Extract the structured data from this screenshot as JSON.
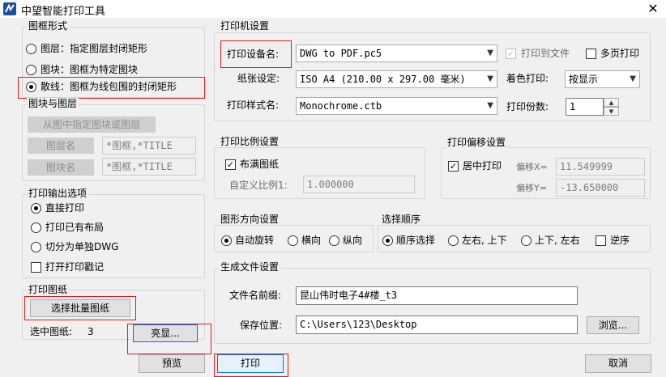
{
  "window": {
    "title": "中望智能打印工具",
    "close": "✕"
  },
  "frame": {
    "title": "图框形式",
    "options": [
      "图层：指定图层封闭矩形",
      "图块：图框为特定图块",
      "散线：图框为线包围的封闭矩形"
    ],
    "selected": 2
  },
  "block_layer": {
    "title": "图块与图层",
    "pick_button": "从图中指定图块或图层",
    "layer_button": "图层名",
    "layer_value": "*图框,*TITLE",
    "block_button": "图块名",
    "block_value": "*图框,*TITLE"
  },
  "output": {
    "title": "打印输出选项",
    "options": [
      "直接打印",
      "打印已有布局",
      "切分为单独DWG"
    ],
    "selected": 0,
    "stamp_label": "打开打印戳记"
  },
  "drawings": {
    "title": "打印图纸",
    "select_button": "选择批量图纸",
    "selected_label": "选中图纸:",
    "selected_count": "3",
    "highlight_button": "亮显..."
  },
  "printer": {
    "title": "打印机设置",
    "device_label": "打印设备名:",
    "device_value": "DWG to PDF.pc5",
    "print_to_file": "打印到文件",
    "multi_page": "多页打印",
    "paper_label": "纸张设定:",
    "paper_value": "ISO A4 (210.00 x 297.00 毫米)",
    "color_label": "着色打印:",
    "color_value": "按显示",
    "style_label": "打印样式名:",
    "style_value": "Monochrome.ctb",
    "copies_label": "打印份数:",
    "copies_value": "1"
  },
  "scale": {
    "title": "打印比例设置",
    "fit_label": "布满图纸",
    "custom_label": "自定义比例1:",
    "custom_value": "1.000000"
  },
  "offset": {
    "title": "打印偏移设置",
    "center_label": "居中打印",
    "x_label": "偏移X=",
    "x_value": "11.549999",
    "y_label": "偏移Y=",
    "y_value": "-13.650000"
  },
  "orientation": {
    "title": "图形方向设置",
    "options": [
      "自动旋转",
      "横向",
      "纵向"
    ],
    "selected": 0
  },
  "order": {
    "title": "选择顺序",
    "options": [
      "顺序选择",
      "左右, 上下",
      "上下, 左右"
    ],
    "selected": 0,
    "reverse_label": "逆序"
  },
  "file": {
    "title": "生成文件设置",
    "prefix_label": "文件名前缀:",
    "prefix_value": "昆山伟时电子4#楼_t3",
    "path_label": "保存位置:",
    "path_value": "C:\\Users\\123\\Desktop",
    "browse_button": "浏览..."
  },
  "actions": {
    "preview": "预览",
    "print": "打印",
    "cancel": "取消"
  },
  "colors": {
    "highlight_red": "#e01b1b",
    "focus_blue": "#0078d7",
    "title_icon": "#1f4e9c"
  }
}
